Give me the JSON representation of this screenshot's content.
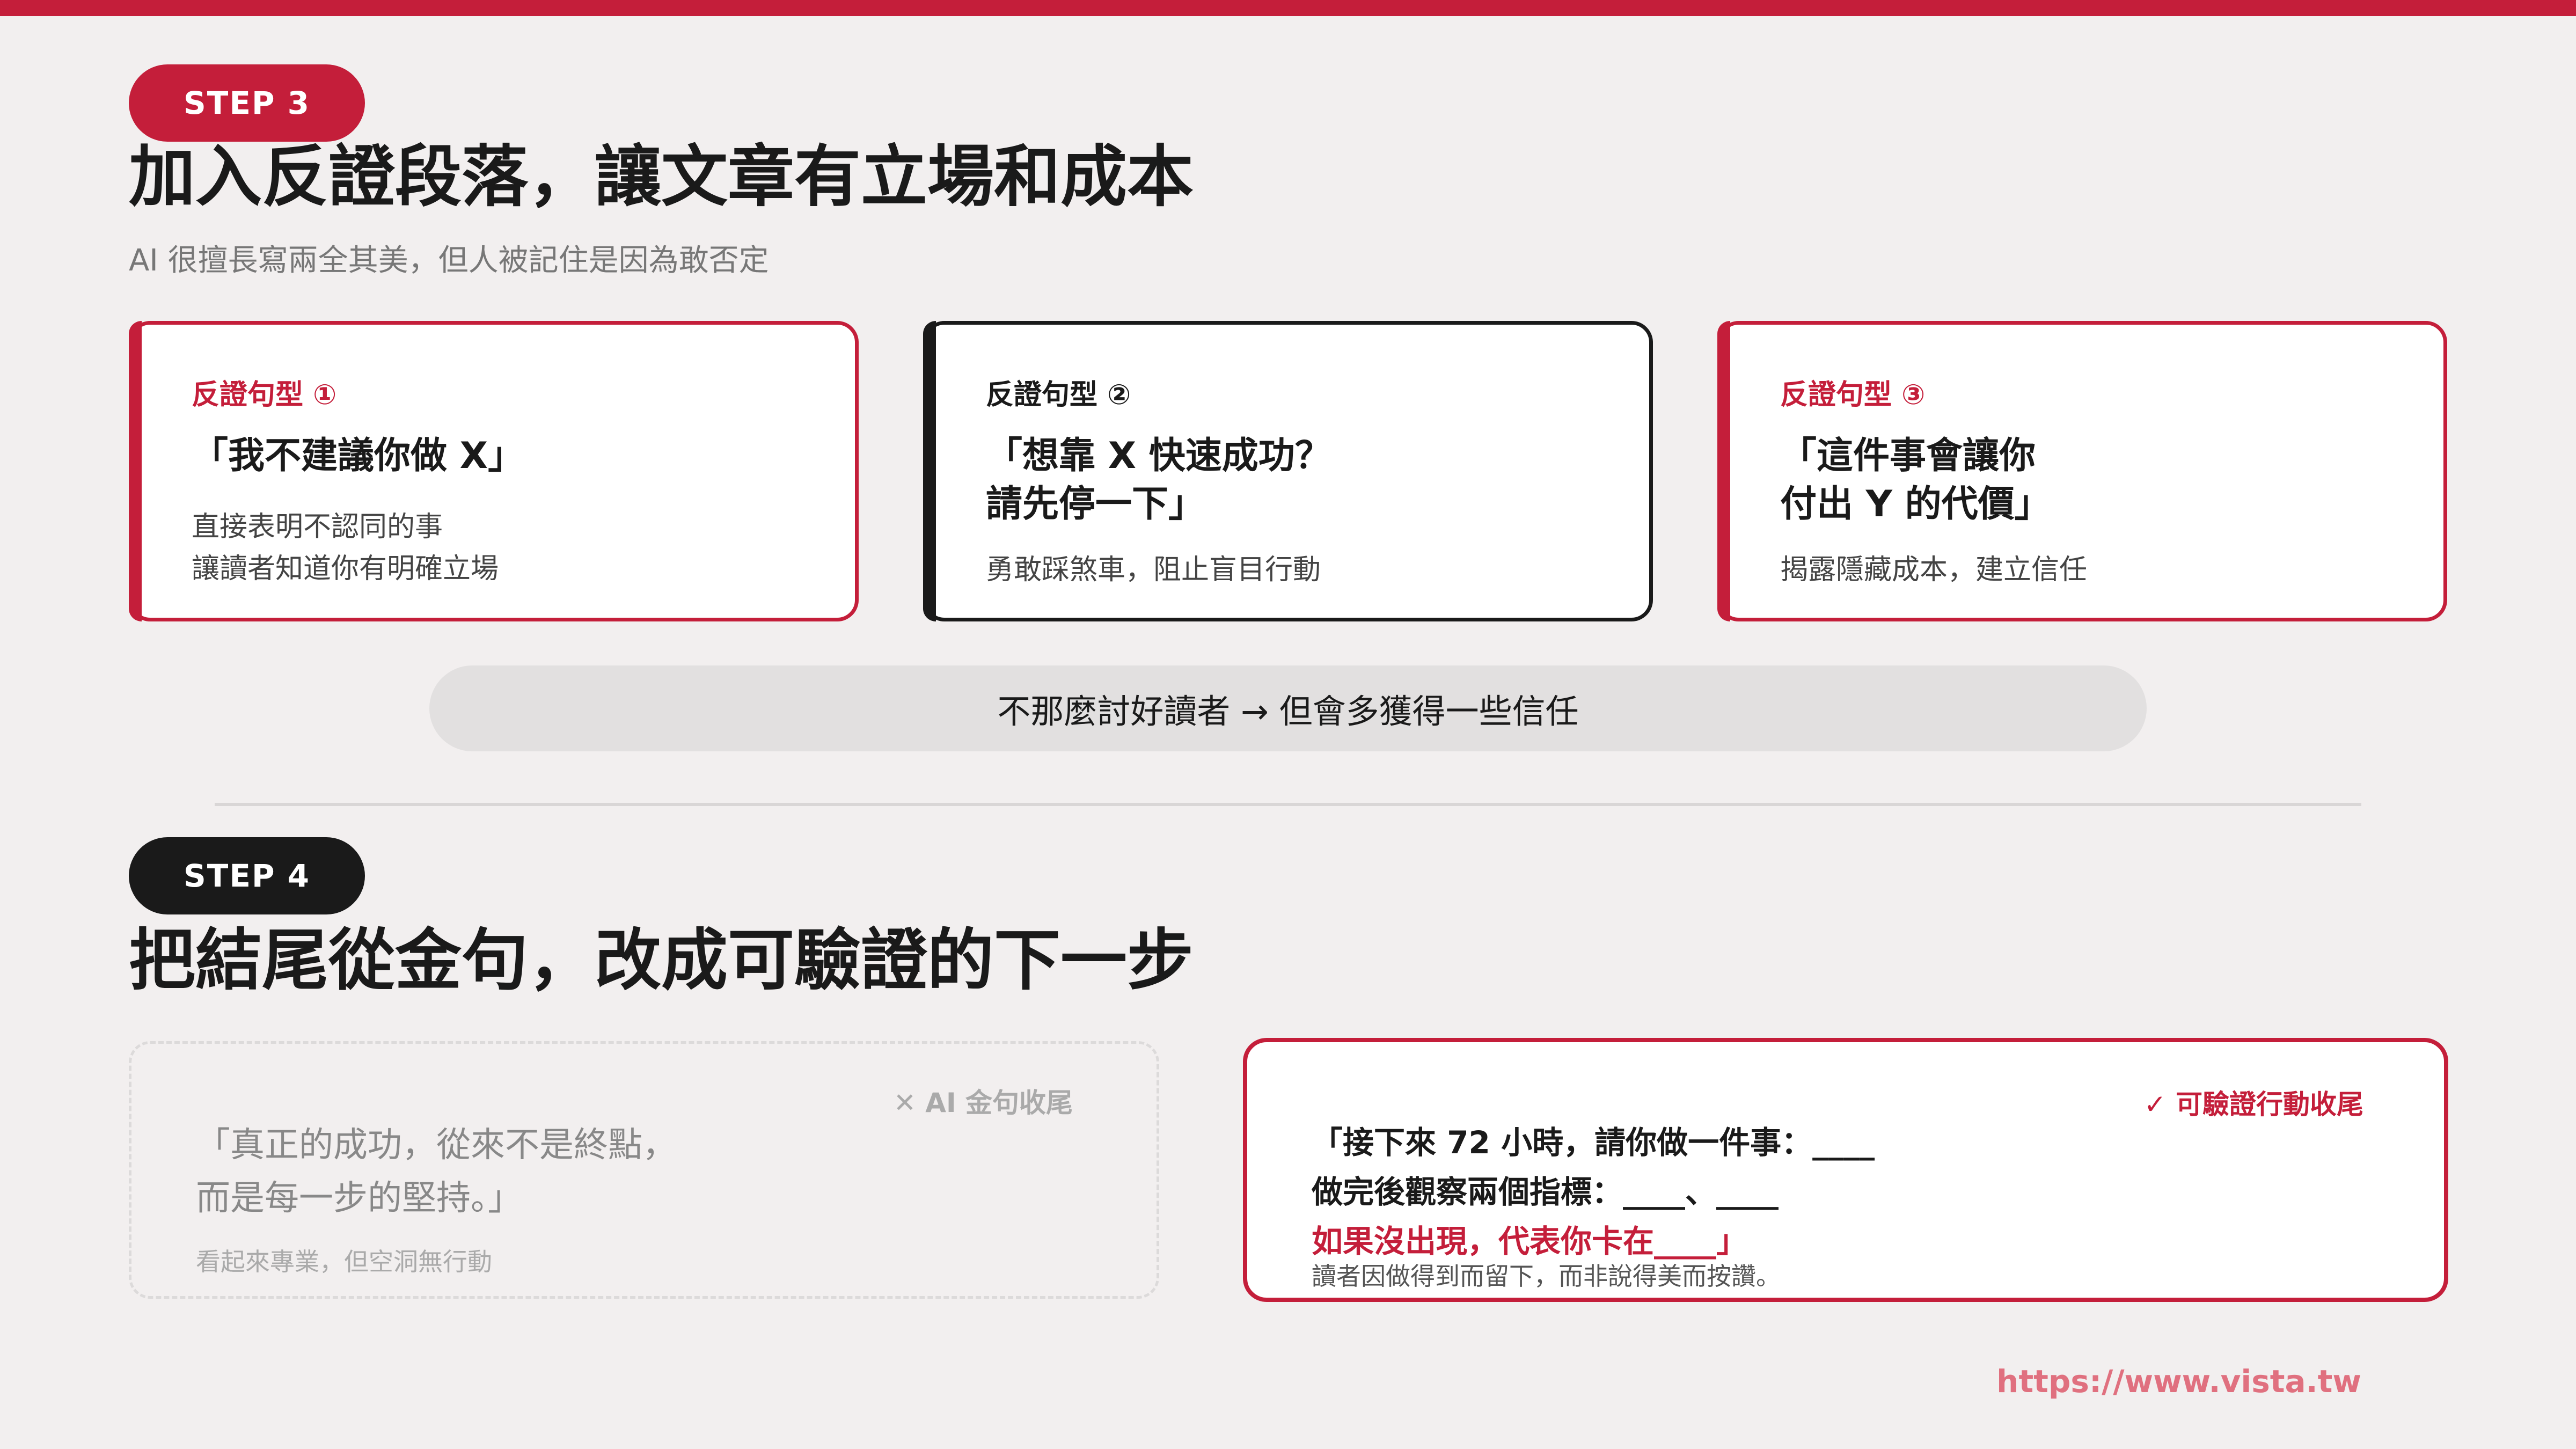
{
  "colors": {
    "accent": "#c41e3a",
    "dark": "#1a1a1a",
    "background": "#f2efef"
  },
  "step3": {
    "badge": "STEP 3",
    "title": "加入反證段落，讓文章有立場和成本",
    "subtitle": "AI 很擅長寫兩全其美，但人被記住是因為敢否定",
    "cards": [
      {
        "tag": "反證句型 ①",
        "quote_lines": [
          "「我不建議你做 X」"
        ],
        "desc_lines": [
          "直接表明不認同的事",
          "讓讀者知道你有明確立場"
        ]
      },
      {
        "tag": "反證句型 ②",
        "quote_lines": [
          "「想靠 X 快速成功？",
          "請先停一下」"
        ],
        "desc_lines": [
          "勇敢踩煞車，阻止盲目行動"
        ]
      },
      {
        "tag": "反證句型 ③",
        "quote_lines": [
          "「這件事會讓你",
          "付出 Y 的代價」"
        ],
        "desc_lines": [
          "揭露隱藏成本，建立信任"
        ]
      }
    ],
    "summary": "不那麼討好讀者 → 但會多獲得一些信任"
  },
  "step4": {
    "badge": "STEP 4",
    "title": "把結尾從金句，改成可驗證的下一步",
    "bad": {
      "mark": "✕ AI 金句收尾",
      "quote_lines": [
        "「真正的成功，從來不是終點，",
        "而是每一步的堅持。」"
      ],
      "note": "看起來專業，但空洞無行動"
    },
    "good": {
      "mark": "✓ 可驗證行動收尾",
      "line1": "「接下來 72 小時，請你做一件事：____",
      "line2": "做完後觀察兩個指標：____、____",
      "line3": "如果沒出現，代表你卡在____」",
      "note": "讀者因做得到而留下，而非說得美而按讚。"
    }
  },
  "footer": {
    "url": "https://www.vista.tw"
  }
}
